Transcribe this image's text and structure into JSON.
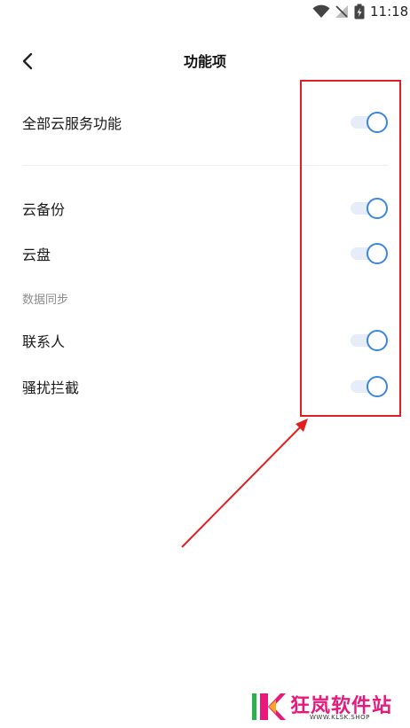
{
  "status_bar": {
    "time": "11:18",
    "icons": [
      "wifi-icon",
      "no-signal-icon",
      "battery-charging-icon"
    ]
  },
  "header": {
    "back_icon": "chevron-left-icon",
    "title": "功能项"
  },
  "master_toggle": {
    "label": "全部云服务功能",
    "enabled": true
  },
  "items": [
    {
      "label": "云备份",
      "enabled": true
    },
    {
      "label": "云盘",
      "enabled": true
    }
  ],
  "data_sync": {
    "section_title": "数据同步",
    "items": [
      {
        "label": "联系人",
        "enabled": true
      },
      {
        "label": "骚扰拦截",
        "enabled": true
      }
    ]
  },
  "watermark": {
    "name": "狂岚软件站",
    "url": "WWW.KLSK.SHOP"
  },
  "colors": {
    "toggle_accent": "#3b86e0",
    "toggle_track": "#e6edf8",
    "annotation": "#e02020",
    "watermark_pink": "#e8197a"
  }
}
